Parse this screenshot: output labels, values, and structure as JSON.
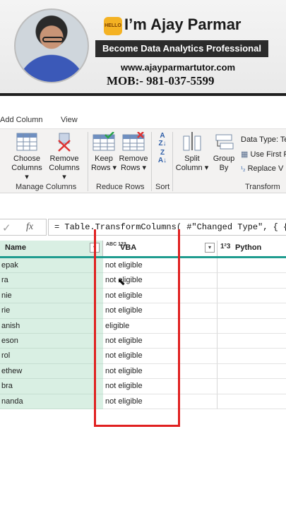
{
  "banner": {
    "hello_badge": "HELLO",
    "name": "I’m Ajay Parmar",
    "tagline": "Become Data Analytics Professional",
    "website": "www.ajayparmartutor.com",
    "phone": "MOB:- 981-037-5599"
  },
  "ribbon": {
    "tabs": [
      "Add Column",
      "View"
    ],
    "buttons": {
      "choose_columns": [
        "Choose",
        "Columns"
      ],
      "remove_columns": [
        "Remove",
        "Columns"
      ],
      "keep_rows": [
        "Keep",
        "Rows"
      ],
      "remove_rows": [
        "Remove",
        "Rows"
      ],
      "split_column": [
        "Split",
        "Column"
      ],
      "group_by": [
        "Group",
        "By"
      ]
    },
    "groups": [
      "Manage Columns",
      "Reduce Rows",
      "Sort",
      "Transform"
    ],
    "transform_items": [
      "Data Type: Te",
      "Use First R",
      "Replace V"
    ]
  },
  "formula_bar": {
    "fx": "fx",
    "formula": "= Table.TransformColumns( #\"Changed Type\", { {\"VB"
  },
  "grid": {
    "columns": [
      {
        "label": "Name",
        "type": ""
      },
      {
        "label": "VBA",
        "type": "ABC 123"
      },
      {
        "label": "Python",
        "type": "1²3"
      }
    ],
    "rows": [
      {
        "name": "epak",
        "vba": "not eligible"
      },
      {
        "name": "ra",
        "vba": "not eligible"
      },
      {
        "name": "nie",
        "vba": "not eligible"
      },
      {
        "name": "rie",
        "vba": "not eligible"
      },
      {
        "name": "anish",
        "vba": "eligible"
      },
      {
        "name": "eson",
        "vba": "not eligible"
      },
      {
        "name": "rol",
        "vba": "not eligible"
      },
      {
        "name": "ethew",
        "vba": "not eligible"
      },
      {
        "name": "bra",
        "vba": "not eligible"
      },
      {
        "name": "nanda",
        "vba": "not eligible"
      }
    ]
  },
  "colors": {
    "accent_teal": "#1f9c8f",
    "name_column": "#d9efe3",
    "annotation_red": "#e02020"
  }
}
